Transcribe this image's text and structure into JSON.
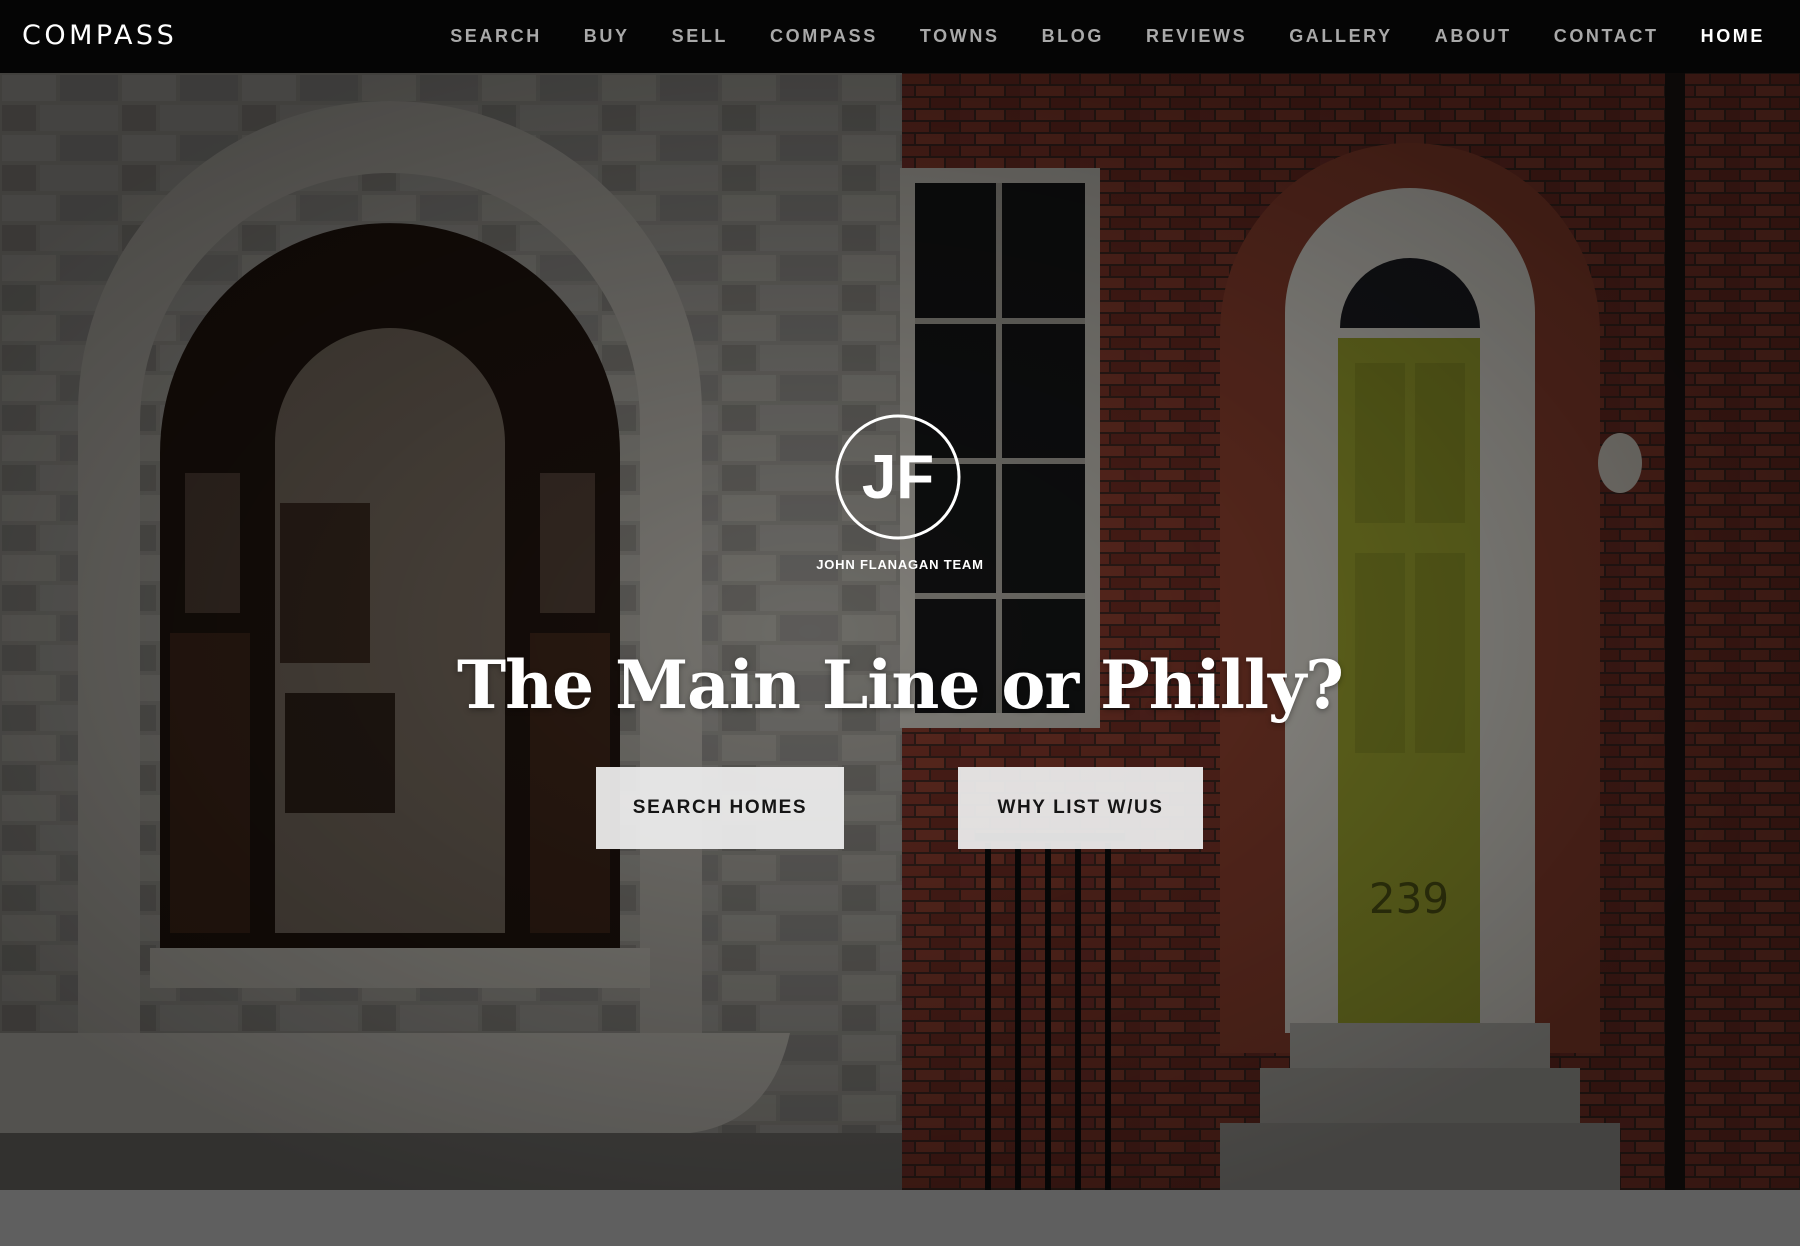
{
  "header": {
    "brand": "COMPASS",
    "nav": [
      {
        "label": "SEARCH",
        "active": false
      },
      {
        "label": "BUY",
        "active": false
      },
      {
        "label": "SELL",
        "active": false
      },
      {
        "label": "COMPASS",
        "active": false
      },
      {
        "label": "TOWNS",
        "active": false
      },
      {
        "label": "BLOG",
        "active": false
      },
      {
        "label": "REVIEWS",
        "active": false
      },
      {
        "label": "GALLERY",
        "active": false
      },
      {
        "label": "ABOUT",
        "active": false
      },
      {
        "label": "CONTACT",
        "active": false
      },
      {
        "label": "HOME",
        "active": true
      }
    ]
  },
  "hero": {
    "logo_monogram": "JF",
    "team_name": "JOHN FLANAGAN TEAM",
    "headline": "The Main Line or Philly?",
    "door_number": "239",
    "buttons": {
      "search_label": "SEARCH HOMES",
      "list_label": "WHY LIST W/US"
    }
  },
  "colors": {
    "nav_bg": "#050505",
    "nav_text": "#a9a9a9",
    "nav_active": "#ffffff",
    "button_bg": "#ececec",
    "door_green": "#9aa12e",
    "brick": "#6b2a22",
    "footer_band": "#5f5f5f"
  }
}
